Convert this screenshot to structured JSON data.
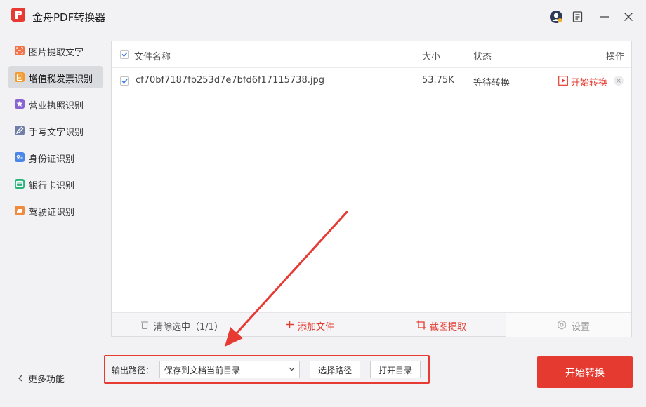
{
  "app": {
    "title": "金舟PDF转换器",
    "icons": [
      "logo-icon",
      "user-avatar-icon",
      "feedback-icon",
      "minimize-icon",
      "close-icon"
    ]
  },
  "sidebar": {
    "items": [
      {
        "label": "图片提取文字",
        "icon": "image-text-icon",
        "color": "#f0744a",
        "active": false
      },
      {
        "label": "增值税发票识别",
        "icon": "invoice-icon",
        "color": "#f29a2e",
        "active": true
      },
      {
        "label": "营业执照识别",
        "icon": "license-star-icon",
        "color": "#8a63d2",
        "active": false
      },
      {
        "label": "手写文字识别",
        "icon": "pen-icon",
        "color": "#6f7fa8",
        "active": false
      },
      {
        "label": "身份证识别",
        "icon": "id-card-icon",
        "color": "#4a86e8",
        "active": false
      },
      {
        "label": "银行卡识别",
        "icon": "bank-card-icon",
        "color": "#27b57a",
        "active": false
      },
      {
        "label": "驾驶证识别",
        "icon": "car-icon",
        "color": "#f08a3c",
        "active": false
      }
    ],
    "more_label": "更多功能"
  },
  "table": {
    "headers": {
      "name": "文件名称",
      "size": "大小",
      "status": "状态",
      "action": "操作"
    },
    "rows": [
      {
        "name": "cf70bf7187fb253d7e7bfd6f17115738.jpg",
        "size": "53.75K",
        "status": "等待转换",
        "action": "开始转换",
        "checked": true
      }
    ]
  },
  "toolbar": {
    "clear": "清除选中（1/1）",
    "add": "添加文件",
    "crop": "截图提取",
    "settings": "设置"
  },
  "output": {
    "label": "输出路径：",
    "selected": "保存到文档当前目录",
    "choose_button": "选择路径",
    "open_button": "打开目录"
  },
  "start_button": "开始转换",
  "colors": {
    "accent": "#e43a2f",
    "checkbox": "#3a7be0",
    "sidebar_active": "#dadbdf"
  }
}
